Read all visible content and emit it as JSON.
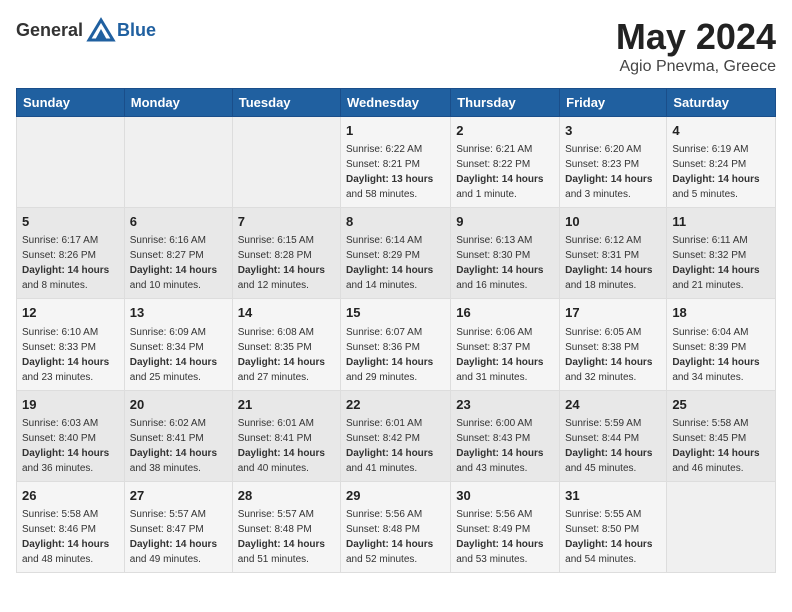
{
  "header": {
    "logo_general": "General",
    "logo_blue": "Blue",
    "month": "May 2024",
    "location": "Agio Pnevma, Greece"
  },
  "weekdays": [
    "Sunday",
    "Monday",
    "Tuesday",
    "Wednesday",
    "Thursday",
    "Friday",
    "Saturday"
  ],
  "weeks": [
    [
      {
        "day": "",
        "info": ""
      },
      {
        "day": "",
        "info": ""
      },
      {
        "day": "",
        "info": ""
      },
      {
        "day": "1",
        "info": "Sunrise: 6:22 AM\nSunset: 8:21 PM\nDaylight: 13 hours\nand 58 minutes."
      },
      {
        "day": "2",
        "info": "Sunrise: 6:21 AM\nSunset: 8:22 PM\nDaylight: 14 hours\nand 1 minute."
      },
      {
        "day": "3",
        "info": "Sunrise: 6:20 AM\nSunset: 8:23 PM\nDaylight: 14 hours\nand 3 minutes."
      },
      {
        "day": "4",
        "info": "Sunrise: 6:19 AM\nSunset: 8:24 PM\nDaylight: 14 hours\nand 5 minutes."
      }
    ],
    [
      {
        "day": "5",
        "info": "Sunrise: 6:17 AM\nSunset: 8:26 PM\nDaylight: 14 hours\nand 8 minutes."
      },
      {
        "day": "6",
        "info": "Sunrise: 6:16 AM\nSunset: 8:27 PM\nDaylight: 14 hours\nand 10 minutes."
      },
      {
        "day": "7",
        "info": "Sunrise: 6:15 AM\nSunset: 8:28 PM\nDaylight: 14 hours\nand 12 minutes."
      },
      {
        "day": "8",
        "info": "Sunrise: 6:14 AM\nSunset: 8:29 PM\nDaylight: 14 hours\nand 14 minutes."
      },
      {
        "day": "9",
        "info": "Sunrise: 6:13 AM\nSunset: 8:30 PM\nDaylight: 14 hours\nand 16 minutes."
      },
      {
        "day": "10",
        "info": "Sunrise: 6:12 AM\nSunset: 8:31 PM\nDaylight: 14 hours\nand 18 minutes."
      },
      {
        "day": "11",
        "info": "Sunrise: 6:11 AM\nSunset: 8:32 PM\nDaylight: 14 hours\nand 21 minutes."
      }
    ],
    [
      {
        "day": "12",
        "info": "Sunrise: 6:10 AM\nSunset: 8:33 PM\nDaylight: 14 hours\nand 23 minutes."
      },
      {
        "day": "13",
        "info": "Sunrise: 6:09 AM\nSunset: 8:34 PM\nDaylight: 14 hours\nand 25 minutes."
      },
      {
        "day": "14",
        "info": "Sunrise: 6:08 AM\nSunset: 8:35 PM\nDaylight: 14 hours\nand 27 minutes."
      },
      {
        "day": "15",
        "info": "Sunrise: 6:07 AM\nSunset: 8:36 PM\nDaylight: 14 hours\nand 29 minutes."
      },
      {
        "day": "16",
        "info": "Sunrise: 6:06 AM\nSunset: 8:37 PM\nDaylight: 14 hours\nand 31 minutes."
      },
      {
        "day": "17",
        "info": "Sunrise: 6:05 AM\nSunset: 8:38 PM\nDaylight: 14 hours\nand 32 minutes."
      },
      {
        "day": "18",
        "info": "Sunrise: 6:04 AM\nSunset: 8:39 PM\nDaylight: 14 hours\nand 34 minutes."
      }
    ],
    [
      {
        "day": "19",
        "info": "Sunrise: 6:03 AM\nSunset: 8:40 PM\nDaylight: 14 hours\nand 36 minutes."
      },
      {
        "day": "20",
        "info": "Sunrise: 6:02 AM\nSunset: 8:41 PM\nDaylight: 14 hours\nand 38 minutes."
      },
      {
        "day": "21",
        "info": "Sunrise: 6:01 AM\nSunset: 8:41 PM\nDaylight: 14 hours\nand 40 minutes."
      },
      {
        "day": "22",
        "info": "Sunrise: 6:01 AM\nSunset: 8:42 PM\nDaylight: 14 hours\nand 41 minutes."
      },
      {
        "day": "23",
        "info": "Sunrise: 6:00 AM\nSunset: 8:43 PM\nDaylight: 14 hours\nand 43 minutes."
      },
      {
        "day": "24",
        "info": "Sunrise: 5:59 AM\nSunset: 8:44 PM\nDaylight: 14 hours\nand 45 minutes."
      },
      {
        "day": "25",
        "info": "Sunrise: 5:58 AM\nSunset: 8:45 PM\nDaylight: 14 hours\nand 46 minutes."
      }
    ],
    [
      {
        "day": "26",
        "info": "Sunrise: 5:58 AM\nSunset: 8:46 PM\nDaylight: 14 hours\nand 48 minutes."
      },
      {
        "day": "27",
        "info": "Sunrise: 5:57 AM\nSunset: 8:47 PM\nDaylight: 14 hours\nand 49 minutes."
      },
      {
        "day": "28",
        "info": "Sunrise: 5:57 AM\nSunset: 8:48 PM\nDaylight: 14 hours\nand 51 minutes."
      },
      {
        "day": "29",
        "info": "Sunrise: 5:56 AM\nSunset: 8:48 PM\nDaylight: 14 hours\nand 52 minutes."
      },
      {
        "day": "30",
        "info": "Sunrise: 5:56 AM\nSunset: 8:49 PM\nDaylight: 14 hours\nand 53 minutes."
      },
      {
        "day": "31",
        "info": "Sunrise: 5:55 AM\nSunset: 8:50 PM\nDaylight: 14 hours\nand 54 minutes."
      },
      {
        "day": "",
        "info": ""
      }
    ]
  ]
}
